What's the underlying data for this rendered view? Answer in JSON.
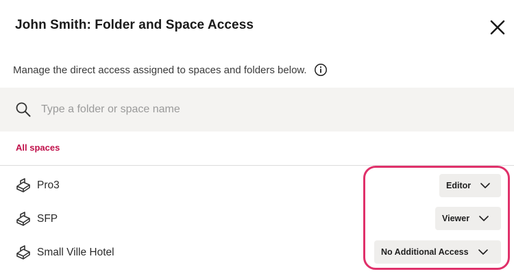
{
  "dialog": {
    "title": "John Smith: Folder and Space Access",
    "description": "Manage the direct access assigned to spaces and folders below."
  },
  "search": {
    "placeholder": "Type a folder or space name",
    "value": ""
  },
  "filter": {
    "all_spaces_label": "All spaces"
  },
  "spaces": [
    {
      "name": "Pro3",
      "access": "Editor",
      "icon": "space-cube-icon"
    },
    {
      "name": "SFP",
      "access": "Viewer",
      "icon": "space-cube-icon"
    },
    {
      "name": "Small Ville Hotel",
      "access": "No Additional Access",
      "icon": "space-cube-icon"
    }
  ],
  "colors": {
    "accent": "#c0104a",
    "highlight_border": "#e0306a",
    "search_background": "#f4f3f1",
    "dropdown_background": "#efeeec"
  }
}
